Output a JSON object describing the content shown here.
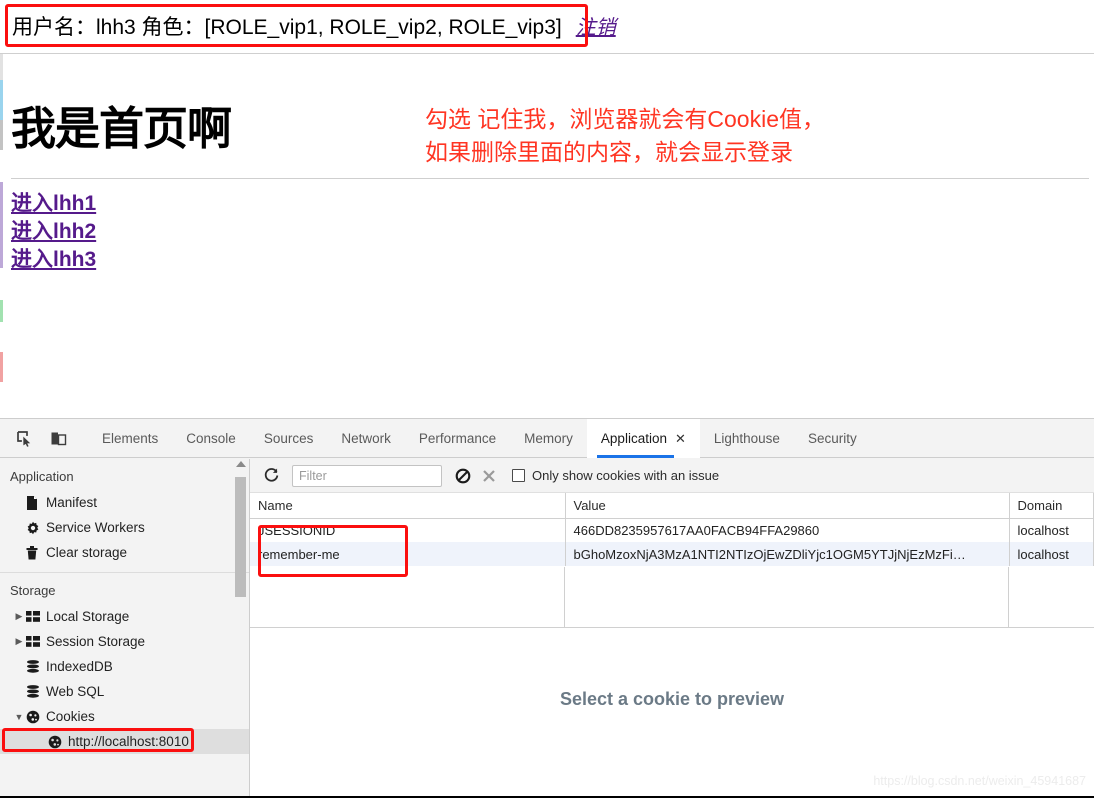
{
  "webpage": {
    "user_bar": {
      "text": "用户名：lhh3 角色：[ROLE_vip1, ROLE_vip2, ROLE_vip3]",
      "logout_label": "注销"
    },
    "heading": "我是首页啊",
    "annotation_note": "勾选 记住我，浏览器就会有Cookie值，\n如果删除里面的内容，就会显示登录",
    "links": [
      {
        "label": "进入lhh1"
      },
      {
        "label": "进入lhh2"
      },
      {
        "label": "进入lhh3"
      }
    ]
  },
  "devtools": {
    "icons": {
      "inspect": "inspect-element-icon",
      "device": "device-toolbar-icon"
    },
    "tabs": [
      {
        "label": "Elements",
        "active": false
      },
      {
        "label": "Console",
        "active": false
      },
      {
        "label": "Sources",
        "active": false
      },
      {
        "label": "Network",
        "active": false
      },
      {
        "label": "Performance",
        "active": false
      },
      {
        "label": "Memory",
        "active": false
      },
      {
        "label": "Application",
        "active": true,
        "close": "✕"
      },
      {
        "label": "Lighthouse",
        "active": false
      },
      {
        "label": "Security",
        "active": false
      }
    ],
    "sidebar": {
      "application_title": "Application",
      "application_items": [
        {
          "label": "Manifest",
          "icon": "manifest-file-icon"
        },
        {
          "label": "Service Workers",
          "icon": "gear-icon"
        },
        {
          "label": "Clear storage",
          "icon": "trash-icon"
        }
      ],
      "storage_title": "Storage",
      "storage_items": [
        {
          "label": "Local Storage",
          "icon": "table-icon",
          "twisty": "▶"
        },
        {
          "label": "Session Storage",
          "icon": "table-icon",
          "twisty": "▶"
        },
        {
          "label": "IndexedDB",
          "icon": "database-icon",
          "twisty": ""
        },
        {
          "label": "Web SQL",
          "icon": "database-icon",
          "twisty": ""
        },
        {
          "label": "Cookies",
          "icon": "cookie-icon",
          "twisty": "▼"
        }
      ],
      "cookie_origin": {
        "label": "http://localhost:8010",
        "icon": "cookie-icon"
      }
    },
    "cookie_panel": {
      "refresh_icon": "refresh-icon",
      "filter_placeholder": "Filter",
      "filter_value": "",
      "clear_all_icon": "clear-all-blocked-icon",
      "delete_icon": "delete-x-icon",
      "issue_checkbox_label": "Only show cookies with an issue",
      "issue_checkbox_checked": false,
      "columns": [
        "Name",
        "Value",
        "Domain"
      ],
      "rows": [
        {
          "name": "JSESSIONID",
          "value": "466DD8235957617AA0FACB94FFA29860",
          "domain": "localhost"
        },
        {
          "name": "remember-me",
          "value": "bGhoMzoxNjA3MzA1NTI2NTIzOjEwZDliYjc1OGM5YTJjNjEzMzFi…",
          "domain": "localhost"
        }
      ],
      "preview_placeholder": "Select a cookie to preview"
    }
  },
  "watermark": "https://blog.csdn.net/weixin_45941687",
  "colors": {
    "annotation_red": "#fb0f0f",
    "note_red": "#ff3523",
    "link_purple": "#551a8b",
    "tab_accent": "#1a73e8",
    "row_alt": "#eff3fb"
  }
}
